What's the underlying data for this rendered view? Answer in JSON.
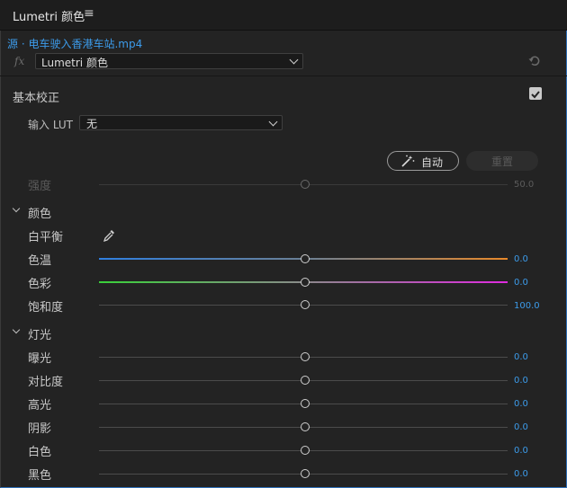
{
  "panel": {
    "title": "Lumetri 颜色",
    "menu_icon": "≡"
  },
  "source": {
    "label": "源 · 电车驶入香港车站.mp4"
  },
  "effect": {
    "fx_label": "fx",
    "name": "Lumetri 颜色"
  },
  "basic": {
    "title": "基本校正",
    "enabled": true,
    "lut_label": "输入 LUT",
    "lut_value": "无",
    "auto_label": "自动",
    "reset_label": "重置",
    "intensity": {
      "label": "强度",
      "value": "50.0",
      "disabled": true
    }
  },
  "color": {
    "title": "颜色",
    "white_balance_label": "白平衡",
    "temperature": {
      "label": "色温",
      "value": "0.0"
    },
    "tint": {
      "label": "色彩",
      "value": "0.0"
    },
    "saturation": {
      "label": "饱和度",
      "value": "100.0"
    }
  },
  "light": {
    "title": "灯光",
    "exposure": {
      "label": "曝光",
      "value": "0.0"
    },
    "contrast": {
      "label": "对比度",
      "value": "0.0"
    },
    "highlights": {
      "label": "高光",
      "value": "0.0"
    },
    "shadows": {
      "label": "阴影",
      "value": "0.0"
    },
    "whites": {
      "label": "白色",
      "value": "0.0"
    },
    "blacks": {
      "label": "黑色",
      "value": "0.0"
    }
  },
  "colors": {
    "accent": "#3c9bea",
    "temp_cold": "#2f7fe0",
    "temp_warm": "#e8892a",
    "tint_green": "#3ad13a",
    "tint_magenta": "#e02be0"
  }
}
